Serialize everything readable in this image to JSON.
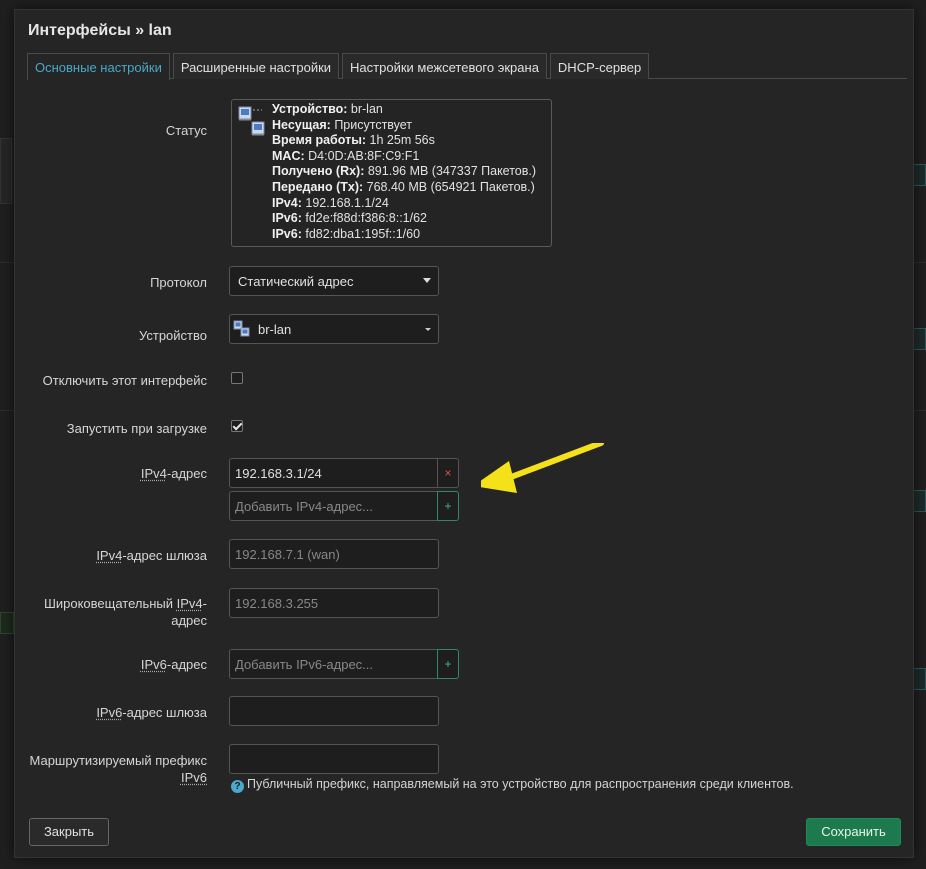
{
  "modal": {
    "title": "Интерфейсы » lan",
    "tabs": [
      {
        "label": "Основные настройки",
        "active": true
      },
      {
        "label": "Расширенные настройки",
        "active": false
      },
      {
        "label": "Настройки межсетевого экрана",
        "active": false
      },
      {
        "label": "DHCP-сервер",
        "active": false
      }
    ]
  },
  "status": {
    "label": "Статус",
    "lines": [
      {
        "key": "Устройство:",
        "value": "br-lan"
      },
      {
        "key": "Несущая:",
        "value": "Присутствует"
      },
      {
        "key": "Время работы:",
        "value": "1h 25m 56s"
      },
      {
        "key": "MAC:",
        "value": "D4:0D:AB:8F:C9:F1"
      },
      {
        "key": "Получено (Rx):",
        "value": "891.96 MB (347337 Пакетов.)"
      },
      {
        "key": "Передано (Tx):",
        "value": "768.40 MB (654921 Пакетов.)"
      },
      {
        "key": "IPv4:",
        "value": "192.168.1.1/24"
      },
      {
        "key": "IPv6:",
        "value": "fd2e:f88d:f386:8::1/62"
      },
      {
        "key": "IPv6:",
        "value": "fd82:dba1:195f::1/60"
      }
    ]
  },
  "protocol": {
    "label": "Протокол",
    "value": "Статический адрес"
  },
  "device": {
    "label": "Устройство",
    "value": "br-lan"
  },
  "disable_iface": {
    "label": "Отключить этот интерфейс",
    "checked": false
  },
  "autostart": {
    "label": "Запустить при загрузке",
    "checked": true
  },
  "ipv4": {
    "label_abbr": "IPv4",
    "label_rest": "-адрес",
    "value": "192.168.3.1/24",
    "remove_symbol": "×",
    "add_placeholder": "Добавить IPv4-адрес...",
    "add_symbol": "+"
  },
  "ipv4_gateway": {
    "label_abbr": "IPv4",
    "label_rest": "-адрес шлюза",
    "placeholder": "192.168.7.1 (wan)"
  },
  "ipv4_broadcast": {
    "label_pre": "Широковещательный ",
    "label_abbr": "IPv4",
    "label_rest": "-адрес",
    "placeholder": "192.168.3.255"
  },
  "ipv6": {
    "label_abbr": "IPv6",
    "label_rest": "-адрес",
    "add_placeholder": "Добавить IPv6-адрес...",
    "add_symbol": "+"
  },
  "ipv6_gateway": {
    "label_abbr": "IPv6",
    "label_rest": "-адрес шлюза",
    "value": ""
  },
  "ipv6_prefix": {
    "label_pre": "Маршрутизируемый префикс ",
    "label_abbr": "IPv6",
    "value": "",
    "help": "Публичный префикс, направляемый на это устройство для распространения среди клиентов.",
    "help_icon": "?"
  },
  "buttons": {
    "close": "Закрыть",
    "save": "Сохранить"
  },
  "colors": {
    "accent": "#4aa8c8",
    "save": "#1d7a4f",
    "arrow": "#f5e11a",
    "remove": "#e05050",
    "add": "#3cc08a"
  }
}
